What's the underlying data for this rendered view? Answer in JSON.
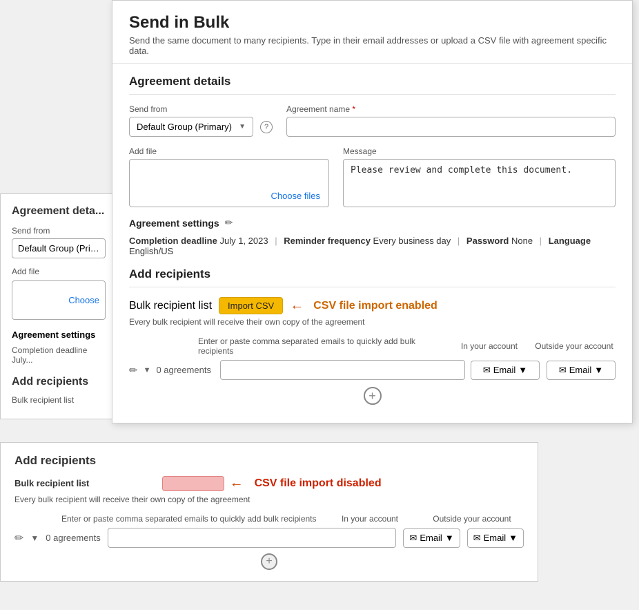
{
  "modal": {
    "title": "Send in Bulk",
    "subtitle": "Send the same document to many recipients. Type in their email addresses or upload a CSV file with agreement specific data.",
    "agreement_details_label": "Agreement details",
    "send_from_label": "Send from",
    "send_from_value": "Default Group (Primary)",
    "agreement_name_label": "Agreement name",
    "agreement_name_required": "*",
    "add_file_label": "Add file",
    "choose_files_label": "Choose files",
    "message_label": "Message",
    "message_value": "Please review and complete this document.",
    "settings_label": "Agreement settings",
    "completion_deadline_key": "Completion deadline",
    "completion_deadline_value": "July 1, 2023",
    "reminder_freq_key": "Reminder frequency",
    "reminder_freq_value": "Every business day",
    "password_key": "Password",
    "password_value": "None",
    "language_key": "Language",
    "language_value": "English/US",
    "add_recipients_label": "Add recipients",
    "bulk_recipient_list_label": "Bulk recipient list",
    "import_csv_btn": "Import CSV",
    "csv_enabled_text": "CSV file import enabled",
    "every_copy_text": "Every bulk recipient will receive their own copy of the agreement",
    "email_col_hint": "Enter or paste comma separated emails to quickly add bulk recipients",
    "in_your_account_label": "In your account",
    "outside_label": "Outside your account",
    "agreements_count": "0 agreements",
    "email_label": "Email",
    "plus_btn": "+",
    "info_icon": "?"
  },
  "background": {
    "agreement_details_label": "Agreement deta...",
    "send_from_label": "Send from",
    "send_from_value": "Default Group (Primary)",
    "add_file_label": "Add file",
    "choose_label": "Choose",
    "settings_label": "Agreement settings",
    "deadline_label": "Completion deadline",
    "deadline_value": "July...",
    "add_recipients_label": "Add recipients",
    "bulk_label": "Bulk recipient list",
    "import_csv_disabled_btn": "",
    "csv_disabled_text": "CSV file import disabled",
    "every_copy_text": "Every bulk recipient will receive their own copy of the agreement",
    "email_col_hint": "Enter or paste comma separated emails to quickly add bulk recipients",
    "in_your_account_label": "In your account",
    "outside_label": "Outside your account",
    "agreements_count": "0 agreements",
    "email_label": "Email",
    "plus_btn": "+"
  }
}
